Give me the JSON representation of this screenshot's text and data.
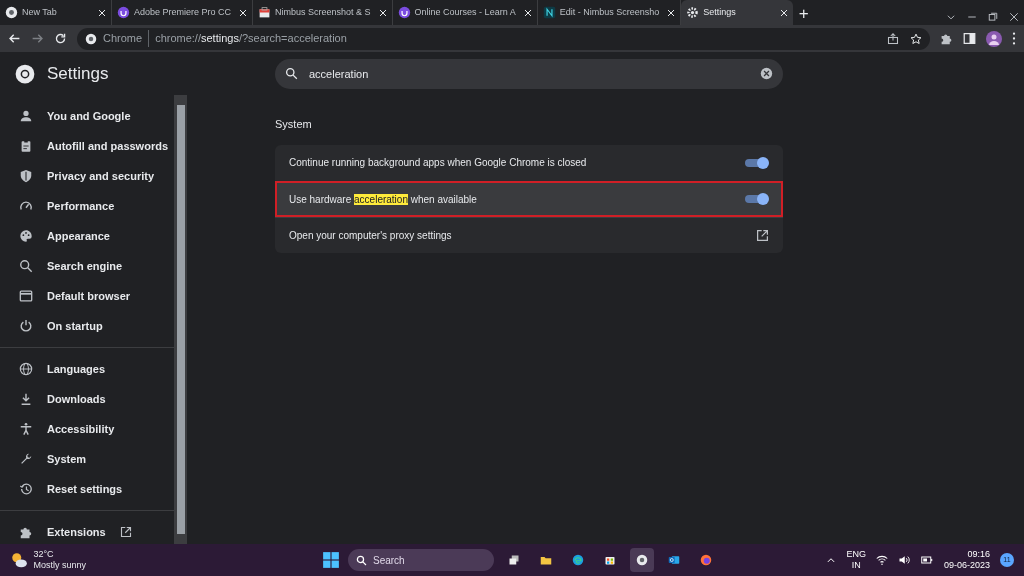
{
  "tabs": [
    {
      "title": "New Tab",
      "selected": false
    },
    {
      "title": "Adobe Premiere Pro CC",
      "selected": false
    },
    {
      "title": "Nimbus Screenshot & S",
      "selected": false
    },
    {
      "title": "Online Courses - Learn A",
      "selected": false
    },
    {
      "title": "Edit - Nimbus Screensho",
      "selected": false
    },
    {
      "title": "Settings",
      "selected": true
    }
  ],
  "new_tab_symbol": "+",
  "address_bar": {
    "site_label": "Chrome",
    "url": "chrome://**settings**/?search=acceleration"
  },
  "header": {
    "title": "Settings"
  },
  "search": {
    "value": "acceleration"
  },
  "sidebar": {
    "groups": [
      [
        {
          "label": "You and Google",
          "selected": false
        },
        {
          "label": "Autofill and passwords",
          "selected": false
        },
        {
          "label": "Privacy and security",
          "selected": false
        },
        {
          "label": "Performance",
          "selected": false
        },
        {
          "label": "Appearance",
          "selected": false
        },
        {
          "label": "Search engine",
          "selected": false
        },
        {
          "label": "Default browser",
          "selected": false
        },
        {
          "label": "On startup",
          "selected": false
        }
      ],
      [
        {
          "label": "Languages",
          "selected": false
        },
        {
          "label": "Downloads",
          "selected": false
        },
        {
          "label": "Accessibility",
          "selected": false
        },
        {
          "label": "System",
          "selected": false
        },
        {
          "label": "Reset settings",
          "selected": false
        }
      ],
      [
        {
          "label": "Extensions",
          "selected": false,
          "external": true
        }
      ]
    ]
  },
  "section": {
    "title": "System",
    "rows": [
      {
        "kind": "toggle",
        "text_before": "Continue running background apps when Google Chrome is closed",
        "match": "",
        "text_after": "",
        "on": true,
        "outlined": false
      },
      {
        "kind": "toggle",
        "text_before": "Use hardware ",
        "match": "acceleration",
        "text_after": " when available",
        "on": true,
        "outlined": true
      },
      {
        "kind": "link",
        "text_before": "Open your computer's proxy settings",
        "match": "",
        "text_after": "",
        "outlined": false
      }
    ]
  },
  "taskbar": {
    "weather": {
      "temperature": "32°C",
      "condition": "Mostly sunny"
    },
    "search_label": "Search",
    "apps": [
      {
        "selected": false
      },
      {
        "selected": false
      },
      {
        "selected": false
      },
      {
        "selected": false
      },
      {
        "selected": true
      },
      {
        "selected": false
      },
      {
        "selected": false
      }
    ],
    "language": "ENG",
    "region": "IN",
    "time": "09:16",
    "date": "09-06-2023",
    "notification_count": "11"
  }
}
